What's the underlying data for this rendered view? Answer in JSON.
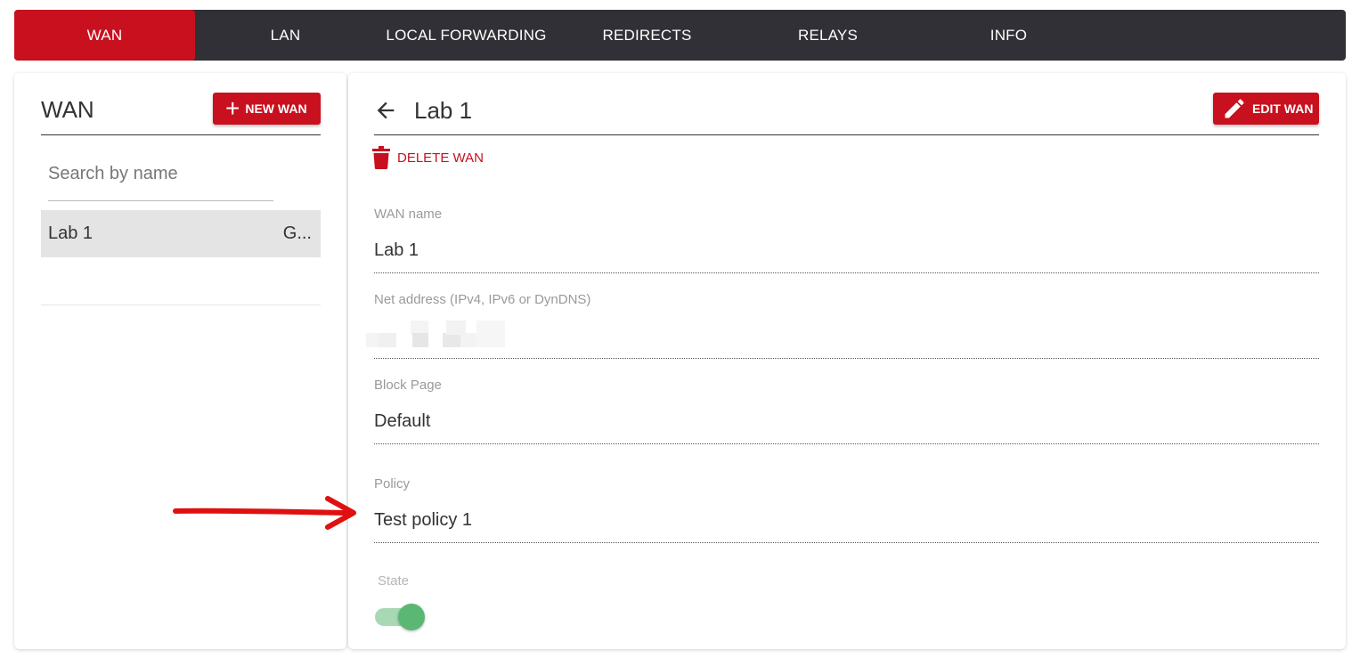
{
  "nav": {
    "tabs": [
      {
        "label": "WAN",
        "active": true
      },
      {
        "label": "LAN",
        "active": false
      },
      {
        "label": "LOCAL FORWARDING",
        "active": false
      },
      {
        "label": "REDIRECTS",
        "active": false
      },
      {
        "label": "RELAYS",
        "active": false
      },
      {
        "label": "INFO",
        "active": false
      }
    ]
  },
  "sidebar": {
    "title": "WAN",
    "new_button_label": "NEW WAN",
    "new_button_icon": "plus-icon",
    "search": {
      "placeholder": "Search by name",
      "value": ""
    },
    "items": [
      {
        "name": "Lab 1",
        "suffix": "G...",
        "selected": true
      }
    ]
  },
  "detail": {
    "back_icon": "arrow-left-icon",
    "title": "Lab 1",
    "edit_button_label": "EDIT WAN",
    "edit_button_icon": "pencil-icon",
    "delete_label": "DELETE WAN",
    "delete_icon": "trash-icon",
    "fields": {
      "wan_name": {
        "label": "WAN name",
        "value": "Lab 1"
      },
      "net_address": {
        "label": "Net address (IPv4, IPv6 or DynDNS)",
        "value": ""
      },
      "block_page": {
        "label": "Block Page",
        "value": "Default"
      },
      "policy": {
        "label": "Policy",
        "value": "Test policy 1"
      }
    },
    "state": {
      "label": "State",
      "enabled": true
    }
  },
  "colors": {
    "accent": "#c8101e",
    "nav_background": "#303036",
    "toggle_on": "#5bb874",
    "annotation_arrow": "#e01010"
  }
}
